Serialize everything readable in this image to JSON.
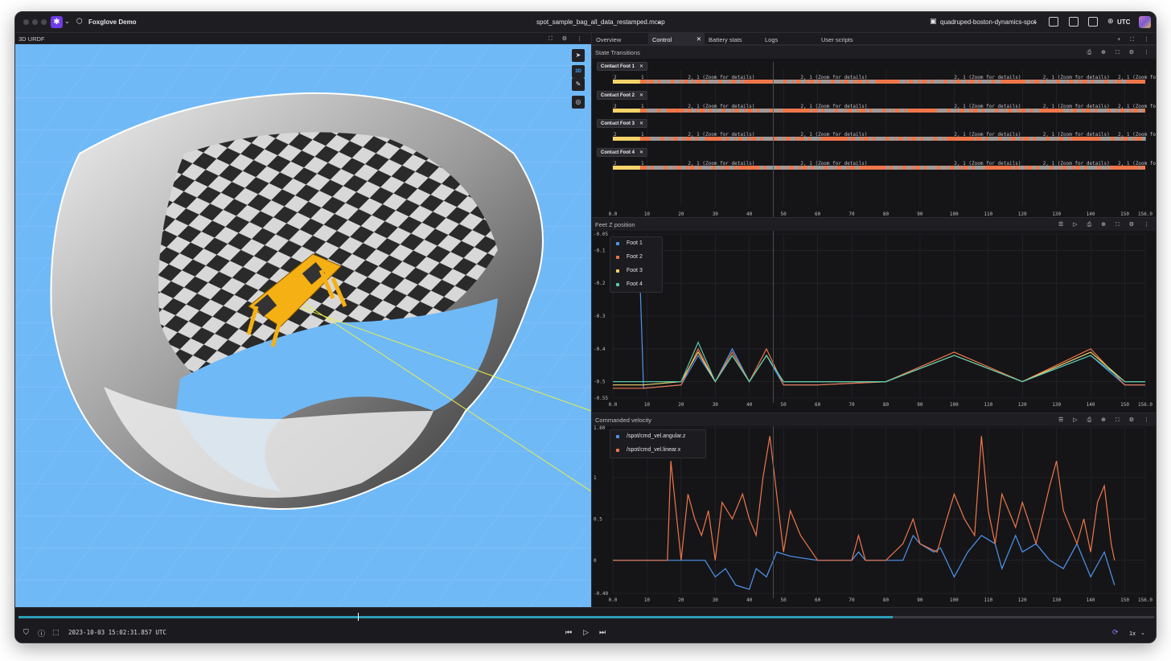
{
  "app": {
    "name": "Foxglove Demo",
    "file": "spot_sample_bag_all_data_restamped.mcap",
    "layout": "quadruped-boston-dynamics-spot",
    "timezone": "UTC"
  },
  "left_panel": {
    "title": "3D URDF",
    "toolbar": [
      "3D"
    ]
  },
  "tabs": [
    {
      "label": "Overview",
      "active": false
    },
    {
      "label": "Control",
      "active": true
    },
    {
      "label": "Battery stats",
      "active": false
    },
    {
      "label": "Logs",
      "active": false
    },
    {
      "label": "User scripts",
      "active": false
    }
  ],
  "state_panel": {
    "title": "State Transitions",
    "feet": [
      "Contact Foot 1",
      "Contact Foot 2",
      "Contact Foot 3",
      "Contact Foot 4"
    ],
    "segment_label": "2, 1 (Zoom for details)",
    "x_ticks": [
      "0.0",
      "10",
      "20",
      "30",
      "40",
      "50",
      "60",
      "70",
      "80",
      "90",
      "100",
      "110",
      "120",
      "130",
      "140",
      "150",
      "156.0"
    ]
  },
  "feet_panel": {
    "title": "Feet Z position",
    "legend": [
      "Foot 1",
      "Foot 2",
      "Foot 3",
      "Foot 4"
    ],
    "colors": [
      "#4f95ee",
      "#f0764a",
      "#f5d36a",
      "#58c9a8"
    ],
    "y_ticks": [
      "-0.05",
      "-0.1",
      "-0.2",
      "-0.3",
      "-0.4",
      "-0.5",
      "-0.55"
    ],
    "x_ticks": [
      "0.0",
      "10",
      "20",
      "30",
      "40",
      "50",
      "60",
      "70",
      "80",
      "90",
      "100",
      "110",
      "120",
      "130",
      "140",
      "150",
      "156.0"
    ]
  },
  "vel_panel": {
    "title": "Commanded velocity",
    "legend": [
      "/spot/cmd_vel.angular.z",
      "/spot/cmd_vel.linear.x"
    ],
    "colors": [
      "#4f95ee",
      "#f0764a"
    ],
    "y_ticks": [
      "1.60",
      "1",
      "0.5",
      "0",
      "-0.40"
    ],
    "x_ticks": [
      "0.0",
      "10",
      "20",
      "30",
      "40",
      "50",
      "60",
      "70",
      "80",
      "90",
      "100",
      "110",
      "120",
      "130",
      "140",
      "150",
      "156.0"
    ]
  },
  "playback": {
    "timestamp": "2023-10-03 15:02:31.857 UTC",
    "speed": "1x",
    "progress": 0.77
  },
  "chart_data": [
    {
      "type": "line",
      "title": "Feet Z position",
      "xlim": [
        0,
        156
      ],
      "ylim": [
        -0.55,
        -0.05
      ],
      "series": [
        {
          "name": "Foot 1",
          "x": [
            0,
            8,
            9,
            20,
            25,
            30,
            35,
            40,
            45,
            50,
            60,
            80,
            100,
            120,
            140,
            150,
            156
          ],
          "y": [
            -0.08,
            -0.2,
            -0.52,
            -0.51,
            -0.42,
            -0.5,
            -0.4,
            -0.5,
            -0.42,
            -0.51,
            -0.51,
            -0.5,
            -0.42,
            -0.5,
            -0.42,
            -0.51,
            -0.51
          ]
        },
        {
          "name": "Foot 2",
          "x": [
            0,
            9,
            20,
            25,
            30,
            35,
            40,
            45,
            50,
            60,
            80,
            100,
            120,
            140,
            150,
            156
          ],
          "y": [
            -0.52,
            -0.52,
            -0.51,
            -0.4,
            -0.5,
            -0.41,
            -0.5,
            -0.4,
            -0.51,
            -0.51,
            -0.5,
            -0.41,
            -0.5,
            -0.4,
            -0.51,
            -0.51
          ]
        },
        {
          "name": "Foot 3",
          "x": [
            0,
            9,
            20,
            25,
            30,
            35,
            40,
            45,
            50,
            60,
            80,
            100,
            120,
            140,
            150,
            156
          ],
          "y": [
            -0.51,
            -0.51,
            -0.5,
            -0.41,
            -0.5,
            -0.42,
            -0.5,
            -0.42,
            -0.5,
            -0.5,
            -0.5,
            -0.42,
            -0.5,
            -0.41,
            -0.5,
            -0.5
          ]
        },
        {
          "name": "Foot 4",
          "x": [
            0,
            9,
            20,
            25,
            30,
            35,
            40,
            45,
            50,
            60,
            80,
            100,
            120,
            140,
            150,
            156
          ],
          "y": [
            -0.5,
            -0.5,
            -0.5,
            -0.38,
            -0.5,
            -0.42,
            -0.5,
            -0.42,
            -0.5,
            -0.5,
            -0.5,
            -0.42,
            -0.5,
            -0.42,
            -0.5,
            -0.5
          ]
        }
      ]
    },
    {
      "type": "line",
      "title": "Commanded velocity",
      "xlim": [
        0,
        156
      ],
      "ylim": [
        -0.4,
        1.6
      ],
      "series": [
        {
          "name": "/spot/cmd_vel.angular.z",
          "x": [
            0,
            27,
            30,
            33,
            36,
            40,
            42,
            45,
            48,
            52,
            60,
            70,
            72,
            74,
            80,
            85,
            88,
            90,
            94,
            96,
            100,
            104,
            108,
            112,
            114,
            118,
            120,
            124,
            128,
            132,
            136,
            140,
            144,
            147
          ],
          "y": [
            0,
            0,
            -0.2,
            -0.1,
            -0.3,
            -0.35,
            -0.1,
            -0.2,
            0.1,
            0.05,
            0,
            0,
            0.1,
            0,
            0,
            0,
            0.3,
            0.2,
            0.1,
            0.15,
            -0.2,
            0.1,
            0.3,
            0.2,
            -0.1,
            0.3,
            0.1,
            0.2,
            0,
            -0.1,
            0.2,
            -0.2,
            0.1,
            -0.3
          ]
        },
        {
          "name": "/spot/cmd_vel.linear.x",
          "x": [
            0,
            16,
            17,
            20,
            22,
            24,
            26,
            28,
            30,
            32,
            35,
            38,
            40,
            42,
            44,
            46,
            48,
            50,
            52,
            55,
            60,
            70,
            72,
            74,
            80,
            85,
            88,
            90,
            95,
            100,
            103,
            106,
            108,
            110,
            112,
            114,
            118,
            120,
            124,
            128,
            130,
            132,
            136,
            138,
            140,
            142,
            144,
            146,
            147
          ],
          "y": [
            0,
            0,
            1.2,
            0,
            0.8,
            0.5,
            0.3,
            0.6,
            0,
            0.7,
            0.5,
            0.8,
            0.5,
            0.3,
            1.0,
            1.5,
            0.8,
            0.1,
            0.6,
            0.3,
            0,
            0,
            0.3,
            0,
            0,
            0.2,
            0.5,
            0.2,
            0.1,
            0.8,
            0.5,
            0.3,
            1.5,
            0.6,
            0.2,
            0.8,
            0.4,
            0.7,
            0.2,
            0.9,
            1.2,
            0.6,
            0.2,
            0.5,
            0.1,
            0.7,
            0.9,
            0.2,
            0
          ]
        }
      ]
    }
  ]
}
